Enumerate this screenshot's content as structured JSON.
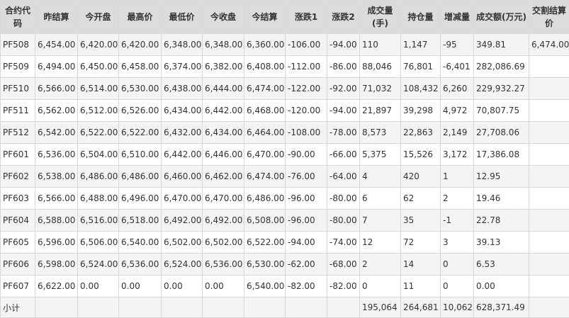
{
  "table": {
    "headers": [
      "合约代码",
      "昨结算",
      "今开盘",
      "最高价",
      "最低价",
      "今收盘",
      "今结算",
      "涨跌1",
      "涨跌2",
      "成交量(手)",
      "持仓量",
      "增减量",
      "成交额(万元)",
      "交割结算价"
    ],
    "rows": [
      [
        "PF508",
        "6,454.00",
        "6,420.00",
        "6,420.00",
        "6,348.00",
        "6,348.00",
        "6,360.00",
        "-106.00",
        "-94.00",
        "110",
        "1,147",
        "-95",
        "349.81",
        "6,474.00"
      ],
      [
        "PF509",
        "6,494.00",
        "6,450.00",
        "6,458.00",
        "6,374.00",
        "6,382.00",
        "6,408.00",
        "-112.00",
        "-86.00",
        "88,046",
        "76,801",
        "-6,401",
        "282,086.69",
        ""
      ],
      [
        "PF510",
        "6,566.00",
        "6,514.00",
        "6,530.00",
        "6,438.00",
        "6,444.00",
        "6,474.00",
        "-122.00",
        "-92.00",
        "71,032",
        "108,432",
        "6,260",
        "229,932.27",
        ""
      ],
      [
        "PF511",
        "6,562.00",
        "6,512.00",
        "6,526.00",
        "6,434.00",
        "6,442.00",
        "6,468.00",
        "-120.00",
        "-94.00",
        "21,897",
        "39,298",
        "4,972",
        "70,807.75",
        ""
      ],
      [
        "PF512",
        "6,542.00",
        "6,522.00",
        "6,522.00",
        "6,432.00",
        "6,434.00",
        "6,464.00",
        "-108.00",
        "-78.00",
        "8,573",
        "22,863",
        "2,149",
        "27,708.06",
        ""
      ],
      [
        "PF601",
        "6,536.00",
        "6,504.00",
        "6,510.00",
        "6,442.00",
        "6,446.00",
        "6,470.00",
        "-90.00",
        "-66.00",
        "5,375",
        "15,526",
        "3,172",
        "17,386.08",
        ""
      ],
      [
        "PF602",
        "6,538.00",
        "6,486.00",
        "6,486.00",
        "6,460.00",
        "6,462.00",
        "6,474.00",
        "-76.00",
        "-64.00",
        "4",
        "420",
        "1",
        "12.95",
        ""
      ],
      [
        "PF603",
        "6,566.00",
        "6,488.00",
        "6,496.00",
        "6,470.00",
        "6,470.00",
        "6,486.00",
        "-96.00",
        "-80.00",
        "6",
        "62",
        "2",
        "19.46",
        ""
      ],
      [
        "PF604",
        "6,588.00",
        "6,516.00",
        "6,518.00",
        "6,492.00",
        "6,492.00",
        "6,508.00",
        "-96.00",
        "-80.00",
        "7",
        "35",
        "-1",
        "22.78",
        ""
      ],
      [
        "PF605",
        "6,596.00",
        "6,506.00",
        "6,540.00",
        "6,502.00",
        "6,502.00",
        "6,522.00",
        "-94.00",
        "-74.00",
        "12",
        "72",
        "3",
        "39.13",
        ""
      ],
      [
        "PF606",
        "6,598.00",
        "6,524.00",
        "6,536.00",
        "6,524.00",
        "6,536.00",
        "6,530.00",
        "-62.00",
        "-68.00",
        "2",
        "14",
        "0",
        "6.53",
        ""
      ],
      [
        "PF607",
        "6,622.00",
        "0.00",
        "0.00",
        "0.00",
        "0.00",
        "6,540.00",
        "-82.00",
        "-82.00",
        "0",
        "11",
        "0",
        "0.00",
        ""
      ]
    ],
    "footer": [
      "小计",
      "",
      "",
      "",
      "",
      "",
      "",
      "",
      "",
      "195,064",
      "264,681",
      "10,062",
      "628,371.49",
      ""
    ]
  }
}
